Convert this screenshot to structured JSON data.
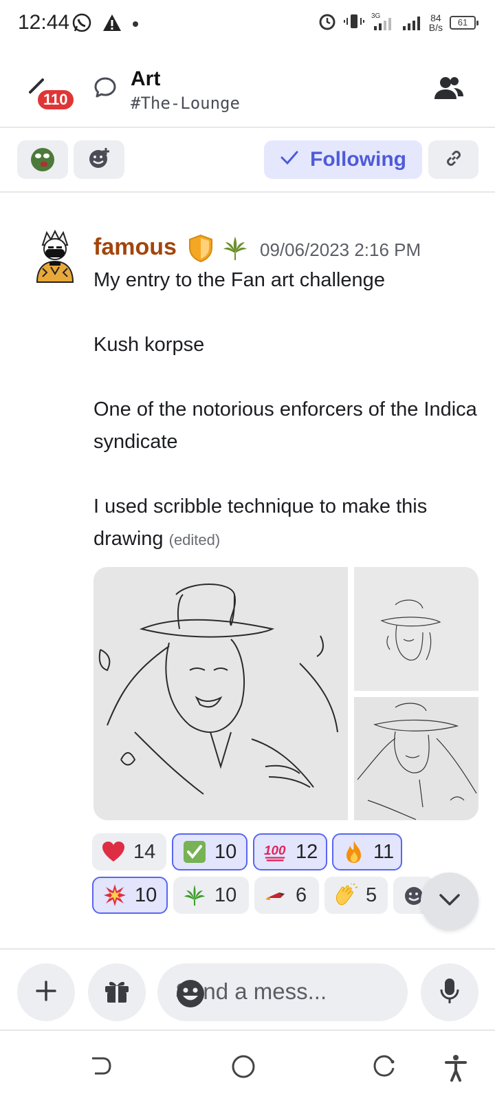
{
  "status_bar": {
    "time": "12:44",
    "net_speed_value": "84",
    "net_speed_unit": "B/s",
    "battery": "61"
  },
  "header": {
    "unread_badge": "110",
    "title": "Art",
    "subtitle": "#The-Lounge"
  },
  "actions": {
    "following_label": "Following"
  },
  "message": {
    "author": "famous",
    "timestamp": "09/06/2023 2:16 PM",
    "lines": [
      "My entry to the Fan art challenge",
      "Kush korpse",
      "One of the notorious enforcers of the Indica syndicate",
      "I used scribble technique to make this drawing"
    ],
    "edited_label": "(edited)"
  },
  "reactions": [
    {
      "emoji": "heart",
      "count": "14",
      "selected": false
    },
    {
      "emoji": "check-mark-button",
      "count": "10",
      "selected": true
    },
    {
      "emoji": "hundred-points",
      "count": "12",
      "selected": true
    },
    {
      "emoji": "fire",
      "count": "11",
      "selected": true
    },
    {
      "emoji": "collision",
      "count": "10",
      "selected": true
    },
    {
      "emoji": "cannabis-leaf",
      "count": "10",
      "selected": false
    },
    {
      "emoji": "rocket-flame",
      "count": "6",
      "selected": false
    },
    {
      "emoji": "clapping-hands",
      "count": "5",
      "selected": false
    }
  ],
  "composer": {
    "placeholder": "Send a mess..."
  },
  "colors": {
    "accent": "#5865f2",
    "username": "#a3450c",
    "badge": "#e03535"
  }
}
